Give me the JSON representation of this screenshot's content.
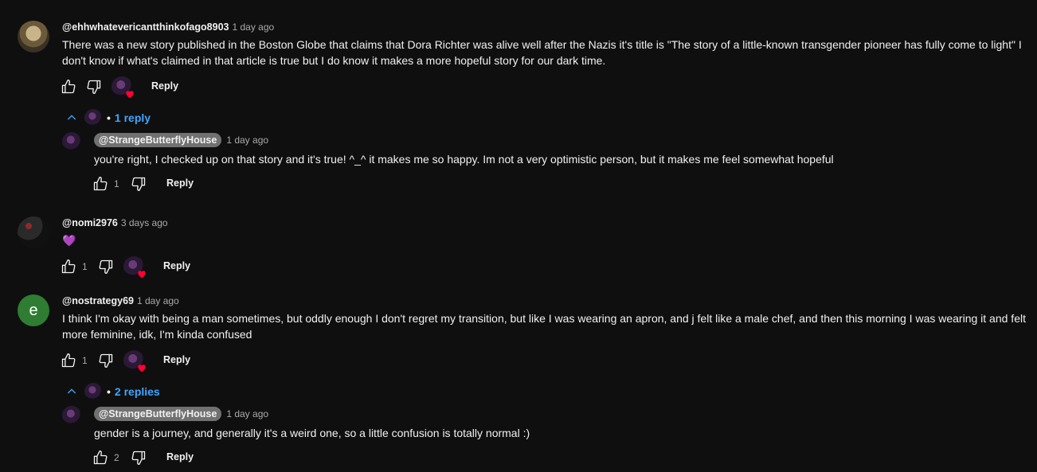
{
  "comments": [
    {
      "author": "@ehhwhatevericantthinkofago8903",
      "time": "1 day ago",
      "text": "There was a new story published in the Boston Globe that claims that Dora Richter was alive well after the Nazis it's title is \"The story of a little-known transgender pioneer has fully come to light\" I don't know if what's claimed in that article is true but I do know it makes a more hopeful story for our dark time.",
      "likes": "",
      "reply_label": "Reply",
      "replies_toggle": "1 reply",
      "replies": [
        {
          "author": "@StrangeButterflyHouse",
          "time": "1 day ago",
          "text": "you're right, I checked up on that story and it's true! ^_^ it makes me so happy. Im not a very optimistic person, but it makes me feel somewhat hopeful",
          "likes": "1",
          "reply_label": "Reply"
        }
      ]
    },
    {
      "author": "@nomi2976",
      "time": "3 days ago",
      "text": "💜",
      "likes": "1",
      "reply_label": "Reply"
    },
    {
      "author": "@nostrategy69",
      "time": "1 day ago",
      "avatar_letter": "e",
      "text": "I think I'm okay with being a man sometimes, but oddly enough I don't regret my transition, but like I was wearing an apron, and j felt like a male chef, and then this morning I was wearing it and felt more feminine, idk, I'm kinda confused",
      "likes": "1",
      "reply_label": "Reply",
      "replies_toggle": "2 replies",
      "replies": [
        {
          "author": "@StrangeButterflyHouse",
          "time": "1 day ago",
          "text": "gender is a journey, and generally it's a weird one, so a little confusion is totally normal :)",
          "likes": "2",
          "reply_label": "Reply"
        }
      ]
    }
  ],
  "colors": {
    "background": "#0f0f0f",
    "link_blue": "#3ea6ff",
    "heart_red": "#ff0033",
    "secondary_text": "#aaaaaa"
  },
  "icons": {
    "like": "thumbs-up-icon",
    "dislike": "thumbs-down-icon",
    "heart": "heart-icon",
    "chevron": "chevron-up-icon"
  }
}
